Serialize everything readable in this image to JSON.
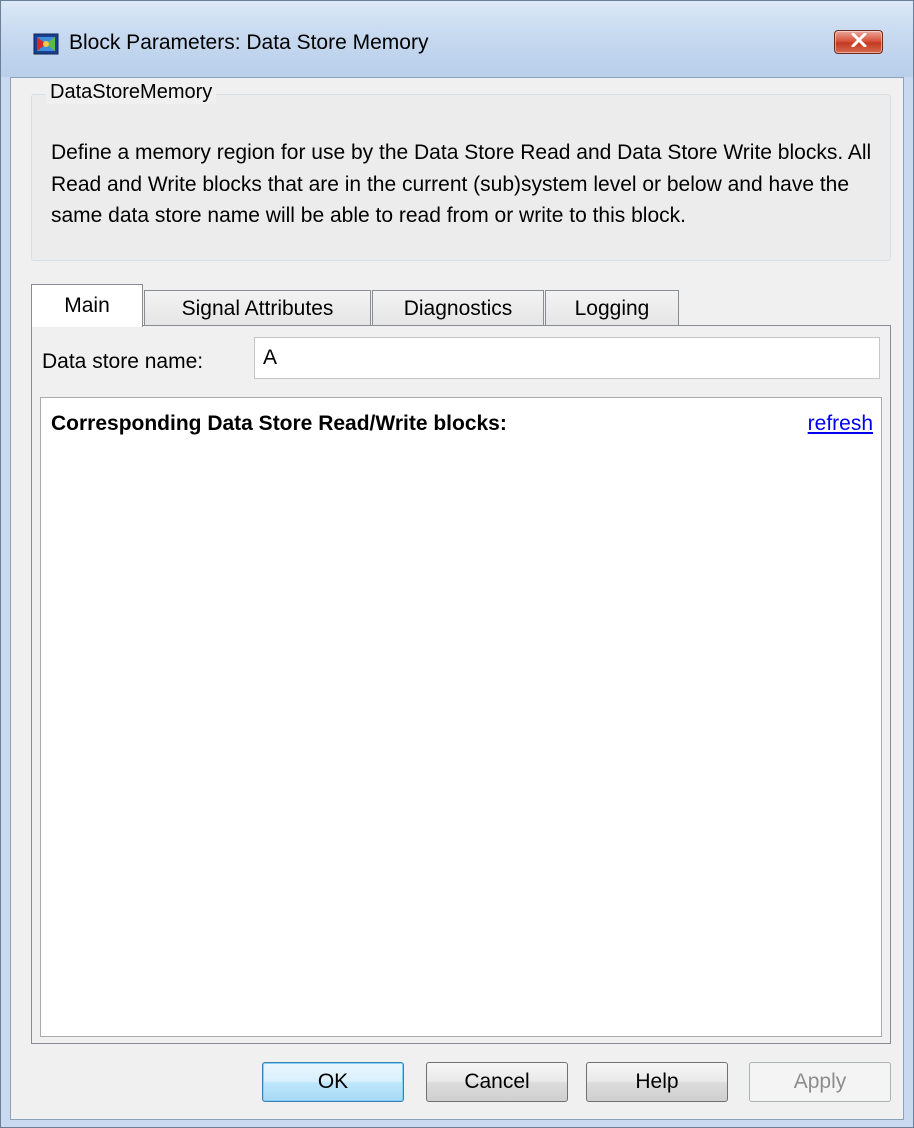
{
  "window": {
    "title": "Block Parameters: Data Store Memory",
    "close_icon": "close-x-icon",
    "app_icon": "simulink-block-icon"
  },
  "group": {
    "title": "DataStoreMemory",
    "description": "Define a memory region for use by the Data Store Read and Data Store Write blocks. All Read and Write blocks that are in the current (sub)system level or below and have the same data store name will be able to read from or write to this block."
  },
  "tabs": [
    {
      "label": "Main",
      "active": true
    },
    {
      "label": "Signal Attributes",
      "active": false
    },
    {
      "label": "Diagnostics",
      "active": false
    },
    {
      "label": "Logging",
      "active": false
    }
  ],
  "main": {
    "data_store_name_label": "Data store name:",
    "data_store_name_value": "A",
    "blocks_heading": "Corresponding Data Store Read/Write blocks:",
    "refresh_label": "refresh"
  },
  "buttons": {
    "ok": "OK",
    "cancel": "Cancel",
    "help": "Help",
    "apply": "Apply"
  }
}
